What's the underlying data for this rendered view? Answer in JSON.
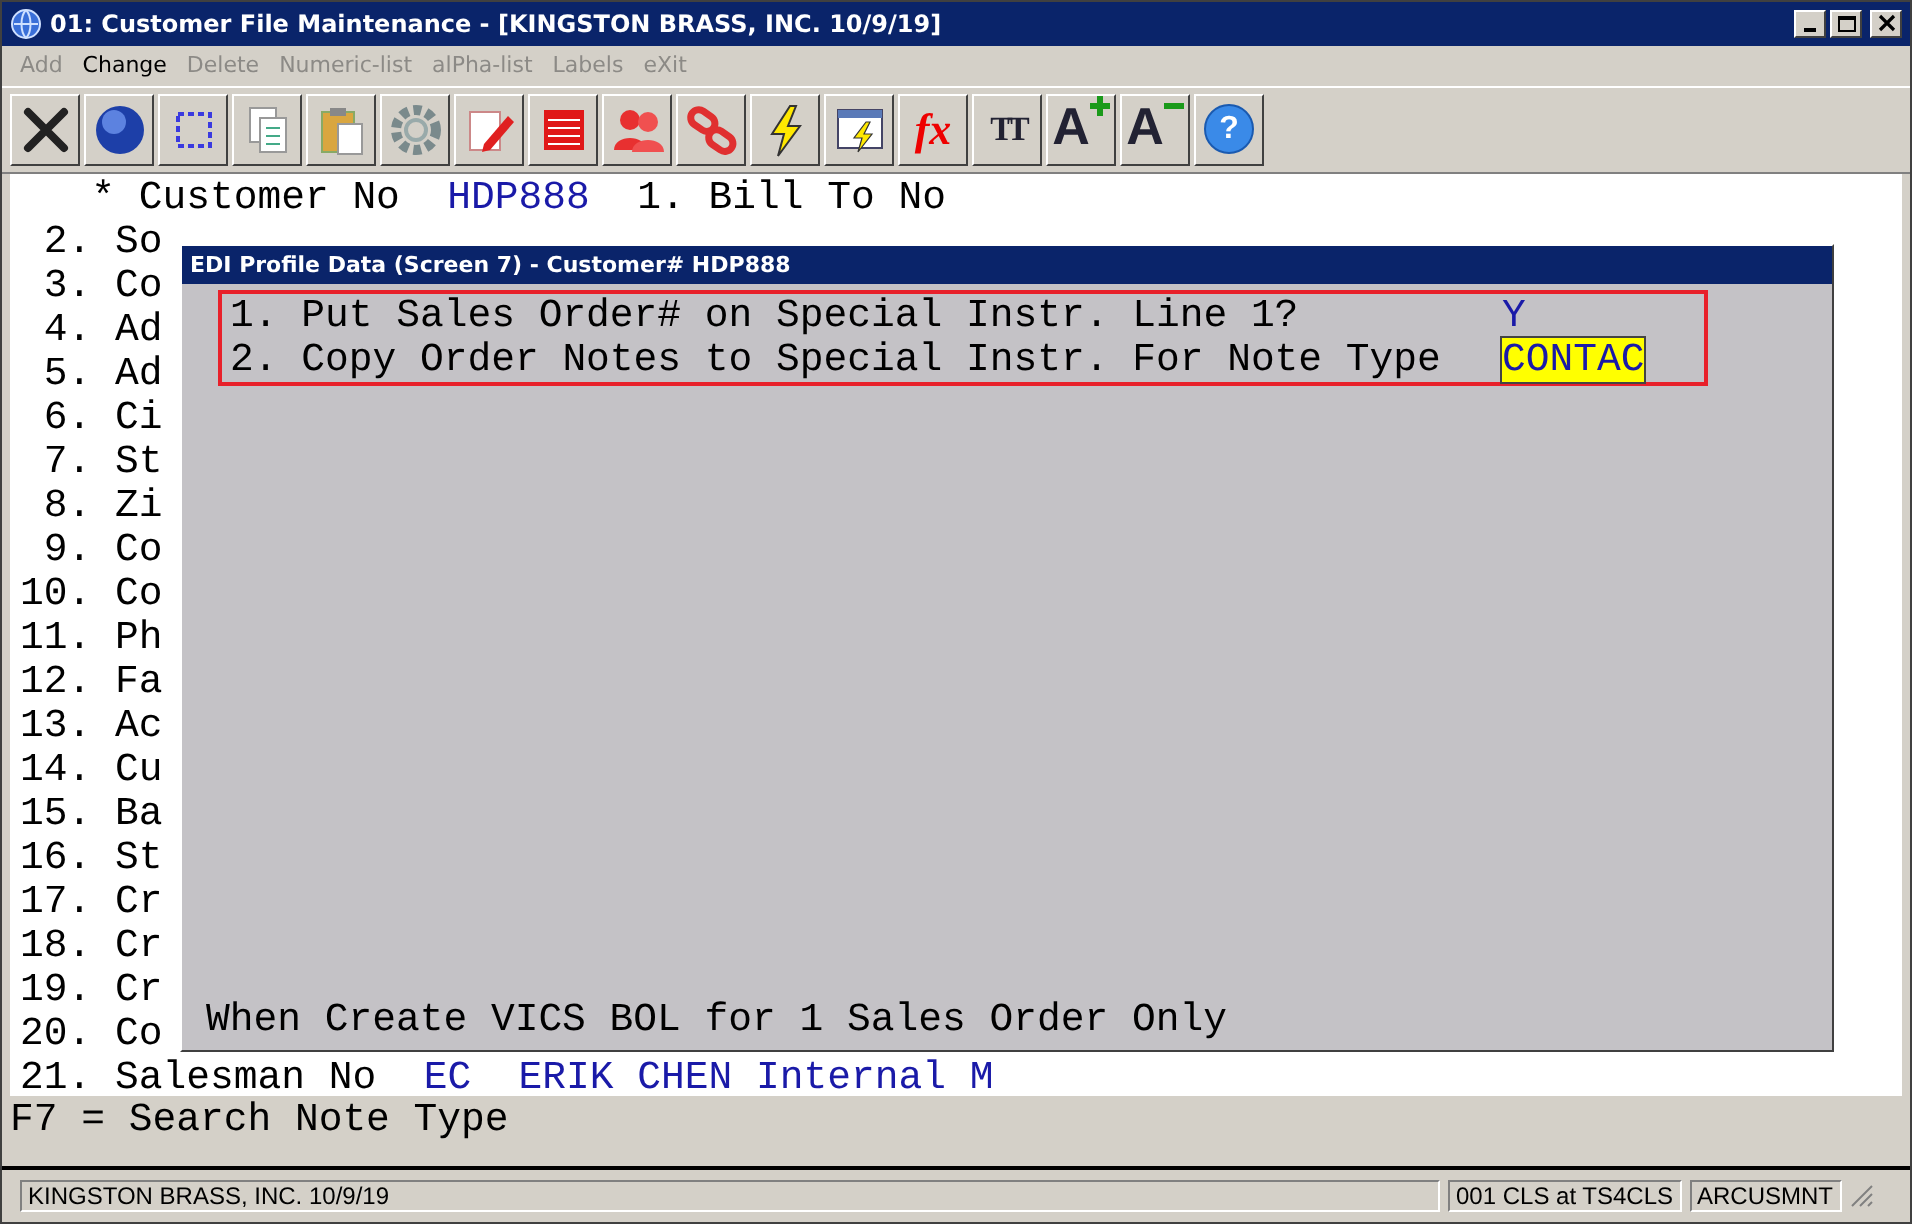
{
  "window": {
    "title": "01: Customer File Maintenance - [KINGSTON BRASS, INC. 10/9/19]"
  },
  "menu": [
    {
      "label": "Add",
      "disabled": true
    },
    {
      "label": "Change",
      "disabled": false
    },
    {
      "label": "Delete",
      "disabled": true
    },
    {
      "label": "Numeric-list",
      "disabled": true
    },
    {
      "label": "alPha-list",
      "disabled": true
    },
    {
      "label": "Labels",
      "disabled": true
    },
    {
      "label": "eXit",
      "disabled": true
    }
  ],
  "toolbar": [
    {
      "kind": "close"
    },
    {
      "kind": "globe"
    },
    {
      "kind": "select"
    },
    {
      "kind": "copy"
    },
    {
      "kind": "paste"
    },
    {
      "kind": "gear"
    },
    {
      "kind": "edit"
    },
    {
      "kind": "table"
    },
    {
      "kind": "users"
    },
    {
      "kind": "link"
    },
    {
      "kind": "bolt"
    },
    {
      "kind": "window-bolt"
    },
    {
      "kind": "text",
      "label": "fx"
    },
    {
      "kind": "font",
      "label": "TT"
    },
    {
      "kind": "grow",
      "label": "A"
    },
    {
      "kind": "shrink",
      "label": "A"
    },
    {
      "kind": "help",
      "label": "?"
    }
  ],
  "screen": {
    "rows": [
      {
        "number": "*",
        "label": "Customer No",
        "value": "HDP888",
        "extra": "1. Bill To No"
      },
      {
        "number": "2.",
        "label": "So"
      },
      {
        "number": "3.",
        "label": "Co"
      },
      {
        "number": "4.",
        "label": "Ad"
      },
      {
        "number": "5.",
        "label": "Ad"
      },
      {
        "number": "6.",
        "label": "Ci"
      },
      {
        "number": "7.",
        "label": "St"
      },
      {
        "number": "8.",
        "label": "Zi"
      },
      {
        "number": "9.",
        "label": "Co"
      },
      {
        "number": "10.",
        "label": "Co"
      },
      {
        "number": "11.",
        "label": "Ph"
      },
      {
        "number": "12.",
        "label": "Fa"
      },
      {
        "number": "13.",
        "label": "Ac"
      },
      {
        "number": "14.",
        "label": "Cu"
      },
      {
        "number": "15.",
        "label": "Ba"
      },
      {
        "number": "16.",
        "label": "St"
      },
      {
        "number": "17.",
        "label": "Cr"
      },
      {
        "number": "18.",
        "label": "Cr"
      },
      {
        "number": "19.",
        "label": "Cr"
      },
      {
        "number": "20.",
        "label": "Co"
      },
      {
        "number": "21.",
        "label": "Salesman No",
        "value": "EC",
        "extra": "ERIK CHEN Internal M"
      }
    ]
  },
  "dialog": {
    "title": "EDI Profile Data (Screen 7) - Customer# HDP888",
    "fields": [
      {
        "label": "1. Put Sales Order# on Special Instr. Line 1?",
        "value": "Y",
        "selected": false
      },
      {
        "label": "2. Copy Order Notes to Special Instr. For Note Type",
        "value": "CONTAC",
        "selected": true
      }
    ],
    "hint": "When Create VICS BOL for 1 Sales Order Only"
  },
  "help_line": "F7 = Search Note Type",
  "status_bar": [
    "KINGSTON BRASS, INC. 10/9/19",
    "001 CLS at TS4CLS",
    "ARCUSMNT"
  ]
}
